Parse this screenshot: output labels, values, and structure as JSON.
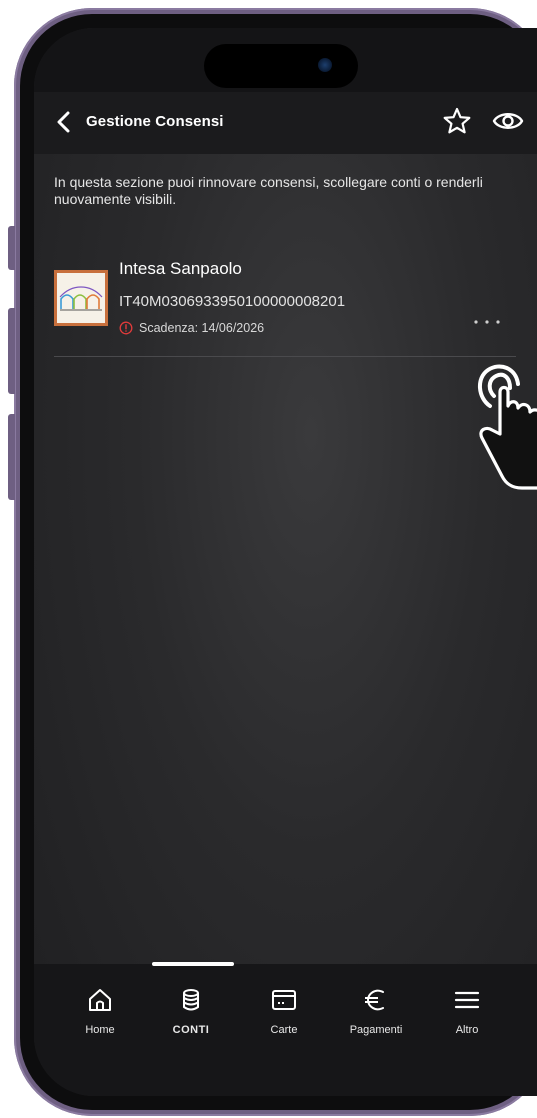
{
  "header": {
    "title": "Gestione Consensi",
    "back_icon": "chevron-left-icon",
    "actions": [
      "star-icon",
      "eye-icon"
    ]
  },
  "intro": {
    "text": "In questa sezione puoi rinnovare consensi, scollegare conti o renderli nuovamente visibili."
  },
  "account": {
    "bank_name": "Intesa Sanpaolo",
    "iban": "IT40M0306933950100000008201",
    "expiry_label": "Scadenza: 14/06/2026",
    "logo_icon": "intesa-sanpaolo-logo",
    "more_icon": "more-horizontal-icon"
  },
  "tabbar": {
    "items": [
      {
        "label": "Home",
        "icon": "home-icon",
        "active": false
      },
      {
        "label": "CONTI",
        "icon": "database-icon",
        "active": true
      },
      {
        "label": "Carte",
        "icon": "card-icon",
        "active": false
      },
      {
        "label": "Pagamenti",
        "icon": "euro-icon",
        "active": false
      },
      {
        "label": "Altro",
        "icon": "menu-icon",
        "active": false
      }
    ]
  },
  "colors": {
    "background": "#2a2a2c",
    "header": "#1b1b1d",
    "tabbar": "#161618",
    "text": "#ffffff",
    "warning": "#e23b3b",
    "logo_border": "#c8703d"
  }
}
